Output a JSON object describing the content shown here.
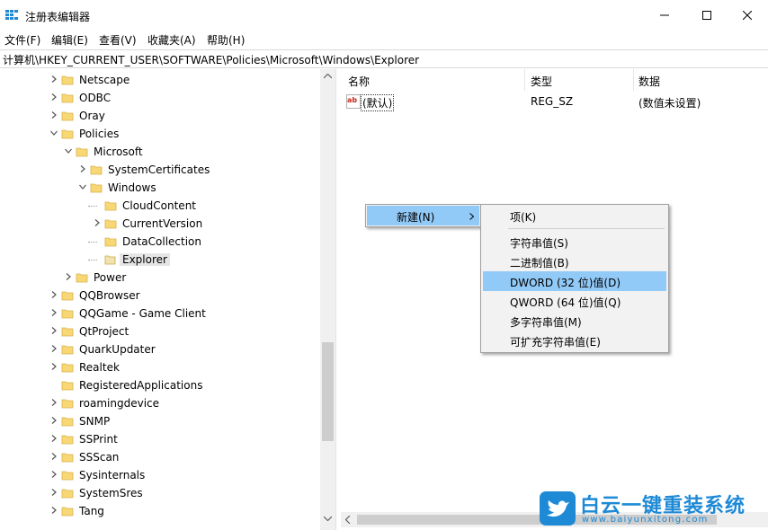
{
  "window": {
    "title": "注册表编辑器",
    "controls": {
      "minimize": "minimize-icon",
      "maximize": "maximize-icon",
      "close": "close-icon"
    }
  },
  "menu": [
    "文件(F)",
    "编辑(E)",
    "查看(V)",
    "收藏夹(A)",
    "帮助(H)"
  ],
  "address": "计算机\\HKEY_CURRENT_USER\\SOFTWARE\\Policies\\Microsoft\\Windows\\Explorer",
  "tree": {
    "items": [
      {
        "label": "Netscape",
        "expander": "collapsed"
      },
      {
        "label": "ODBC",
        "expander": "collapsed"
      },
      {
        "label": "Oray",
        "expander": "collapsed"
      },
      {
        "label": "Policies",
        "expander": "expanded"
      },
      {
        "label": "Microsoft",
        "expander": "expanded"
      },
      {
        "label": "SystemCertificates",
        "expander": "collapsed"
      },
      {
        "label": "Windows",
        "expander": "expanded"
      },
      {
        "label": "CloudContent",
        "expander": "none"
      },
      {
        "label": "CurrentVersion",
        "expander": "collapsed"
      },
      {
        "label": "DataCollection",
        "expander": "none"
      },
      {
        "label": "Explorer",
        "expander": "none",
        "selected": true
      },
      {
        "label": "Power",
        "expander": "collapsed"
      },
      {
        "label": "QQBrowser",
        "expander": "collapsed"
      },
      {
        "label": "QQGame - Game Client",
        "expander": "collapsed"
      },
      {
        "label": "QtProject",
        "expander": "collapsed"
      },
      {
        "label": "QuarkUpdater",
        "expander": "collapsed"
      },
      {
        "label": "Realtek",
        "expander": "collapsed"
      },
      {
        "label": "RegisteredApplications",
        "expander": "none"
      },
      {
        "label": "roamingdevice",
        "expander": "collapsed"
      },
      {
        "label": "SNMP",
        "expander": "collapsed"
      },
      {
        "label": "SSPrint",
        "expander": "collapsed"
      },
      {
        "label": "SSScan",
        "expander": "collapsed"
      },
      {
        "label": "Sysinternals",
        "expander": "collapsed"
      },
      {
        "label": "SystemSres",
        "expander": "collapsed"
      },
      {
        "label": "Tang",
        "expander": "collapsed"
      }
    ]
  },
  "list": {
    "columns": [
      "名称",
      "类型",
      "数据"
    ],
    "rows": [
      {
        "icon": "ab-string-icon",
        "name": "(默认)",
        "type": "REG_SZ",
        "data": "(数值未设置)"
      }
    ]
  },
  "context_menu": {
    "new_label": "新建(N)",
    "submenu": [
      "项(K)",
      "字符串值(S)",
      "二进制值(B)",
      "DWORD (32 位)值(D)",
      "QWORD (64 位)值(Q)",
      "多字符串值(M)",
      "可扩充字符串值(E)"
    ],
    "highlighted": "DWORD (32 位)值(D)"
  },
  "watermark": {
    "text": "白云一键重装系统",
    "url": "www.baiyunxitong.com"
  },
  "colors": {
    "accent": "#1e8ad6",
    "highlight": "#91c9f7",
    "menu_bg": "#f2f2f2",
    "folder": "#f8d775"
  }
}
